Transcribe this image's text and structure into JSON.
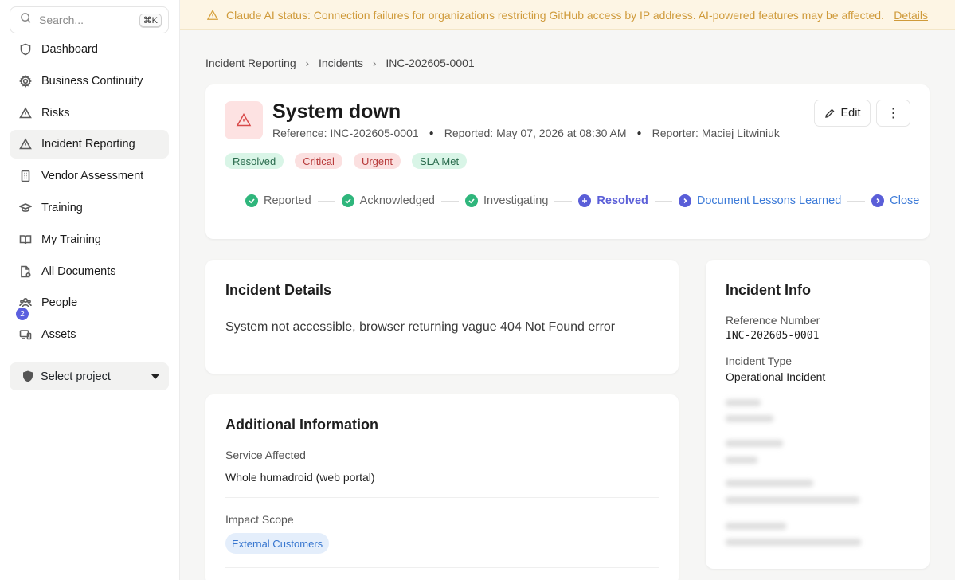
{
  "sidebar": {
    "search_placeholder": "Search...",
    "search_shortcut": "⌘K",
    "items": [
      {
        "label": "Dashboard",
        "icon": "shield-icon"
      },
      {
        "label": "Business Continuity",
        "icon": "gear-icon"
      },
      {
        "label": "Risks",
        "icon": "warning-icon"
      },
      {
        "label": "Incident Reporting",
        "icon": "warning-icon"
      },
      {
        "label": "Vendor Assessment",
        "icon": "building-icon"
      },
      {
        "label": "Training",
        "icon": "graduation-cap-icon"
      },
      {
        "label": "My Training",
        "icon": "book-icon"
      },
      {
        "label": "All Documents",
        "icon": "document-icon"
      },
      {
        "label": "People",
        "icon": "people-icon"
      },
      {
        "label": "Assets",
        "icon": "devices-icon"
      }
    ],
    "people_badge": "2",
    "project_select": "Select project"
  },
  "banner": {
    "message": "Claude AI status: Connection failures for organizations restricting GitHub access by IP address. AI-powered features may be affected.",
    "link": "Details",
    "color": "#cf9a3a"
  },
  "breadcrumb": [
    "Incident Reporting",
    "Incidents",
    "INC-202605-0001"
  ],
  "incident": {
    "title": "System down",
    "reference": "Reference: INC-202605-0001",
    "reported": "Reported: May 07, 2026 at 08:30 AM",
    "reporter": "Reporter: Maciej Litwiniuk",
    "edit_label": "Edit",
    "more_label": "⋮",
    "tags": [
      "Resolved",
      "Critical",
      "Urgent",
      "SLA Met"
    ],
    "steps": [
      "Reported",
      "Acknowledged",
      "Investigating",
      "Resolved",
      "Document Lessons Learned",
      "Close"
    ]
  },
  "details": {
    "heading": "Incident Details",
    "description": "System not accessible, browser returning vague 404 Not Found error"
  },
  "additional": {
    "heading": "Additional Information",
    "service_label": "Service Affected",
    "service_value": "Whole humadroid (web portal)",
    "impact_label": "Impact Scope",
    "impact_value": "External Customers"
  },
  "info": {
    "heading": "Incident Info",
    "ref_label": "Reference Number",
    "ref_value": "INC-202605-0001",
    "type_label": "Incident Type",
    "type_value": "Operational Incident"
  }
}
